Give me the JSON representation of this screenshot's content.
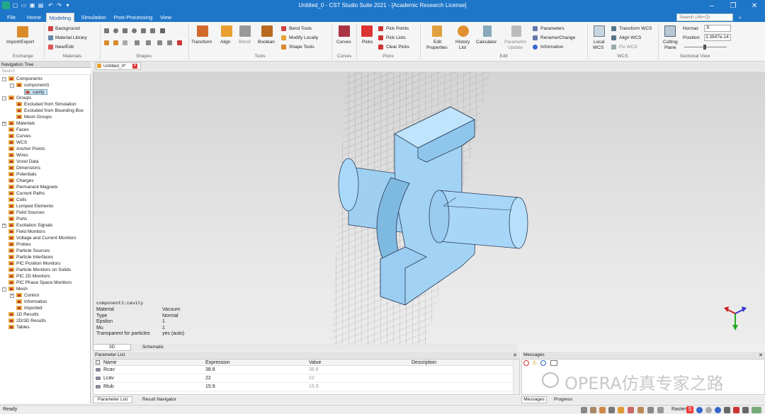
{
  "title": "Untitled_0 - CST Studio Suite 2021 - [Academic Research License]",
  "menu_tabs": [
    "File",
    "Home",
    "Modeling",
    "Simulation",
    "Post-Processing",
    "View"
  ],
  "active_tab": "Modeling",
  "search_placeholder": "Search (Alt+Q)",
  "ribbon": {
    "exchange": {
      "label": "Exchange",
      "import_export": "Import/Export"
    },
    "materials": {
      "label": "Materials",
      "background": "Background",
      "material_library": "Material Library",
      "new_edit": "New/Edit"
    },
    "shapes": {
      "label": "Shapes"
    },
    "tools": {
      "label": "Tools",
      "transform": "Transform",
      "align": "Align",
      "blend": "Blend",
      "boolean": "Boolean",
      "bend_tools": "Bend Tools",
      "modify_locally": "Modify Locally",
      "shape_tools": "Shape Tools"
    },
    "curves": {
      "label": "Curves",
      "curves": "Curves"
    },
    "picks": {
      "label": "Picks",
      "picks": "Picks",
      "pick_points": "Pick Points",
      "pick_lists": "Pick Lists",
      "clear_picks": "Clear Picks"
    },
    "edit": {
      "label": "Edit",
      "edit_properties_1": "Edit",
      "edit_properties_2": "Properties",
      "history_list_1": "History",
      "history_list_2": "List",
      "calculator": "Calculator",
      "parametric_update_1": "Parametric",
      "parametric_update_2": "Update",
      "parameters": "Parameters",
      "rename_change": "Rename/Change",
      "information": "Information"
    },
    "wcs": {
      "label": "WCS",
      "local_wcs_1": "Local",
      "local_wcs_2": "WCS",
      "transform_wcs": "Transform WCS",
      "align_wcs": "Align WCS",
      "fix_wcs": "Fix WCS"
    },
    "sectional": {
      "label": "Sectional View",
      "cutting_plane_1": "Cutting",
      "cutting_plane_2": "Plane",
      "normal_label": "Normal:",
      "normal_value": "X",
      "position_label": "Position:",
      "position_value": "3.3947e-14"
    }
  },
  "doc_tab": "Untitled_0*",
  "nav": {
    "title": "Navigation Tree",
    "search": "Search",
    "items": [
      {
        "label": "Components",
        "lvl": 0,
        "exp": "-"
      },
      {
        "label": "component1",
        "lvl": 1,
        "exp": "-"
      },
      {
        "label": "cavity",
        "lvl": 2,
        "exp": "",
        "sel": true
      },
      {
        "label": "Groups",
        "lvl": 0,
        "exp": "-"
      },
      {
        "label": "Excluded from Simulation",
        "lvl": 1,
        "exp": ""
      },
      {
        "label": "Excluded from Bounding Box",
        "lvl": 1,
        "exp": ""
      },
      {
        "label": "Mesh Groups",
        "lvl": 1,
        "exp": ""
      },
      {
        "label": "Materials",
        "lvl": 0,
        "exp": "+"
      },
      {
        "label": "Faces",
        "lvl": 0,
        "exp": ""
      },
      {
        "label": "Curves",
        "lvl": 0,
        "exp": ""
      },
      {
        "label": "WCS",
        "lvl": 0,
        "exp": ""
      },
      {
        "label": "Anchor Points",
        "lvl": 0,
        "exp": ""
      },
      {
        "label": "Wires",
        "lvl": 0,
        "exp": ""
      },
      {
        "label": "Voxel Data",
        "lvl": 0,
        "exp": ""
      },
      {
        "label": "Dimensions",
        "lvl": 0,
        "exp": ""
      },
      {
        "label": "Potentials",
        "lvl": 0,
        "exp": ""
      },
      {
        "label": "Charges",
        "lvl": 0,
        "exp": ""
      },
      {
        "label": "Permanent Magnets",
        "lvl": 0,
        "exp": ""
      },
      {
        "label": "Current Paths",
        "lvl": 0,
        "exp": ""
      },
      {
        "label": "Coils",
        "lvl": 0,
        "exp": ""
      },
      {
        "label": "Lumped Elements",
        "lvl": 0,
        "exp": ""
      },
      {
        "label": "Field Sources",
        "lvl": 0,
        "exp": ""
      },
      {
        "label": "Ports",
        "lvl": 0,
        "exp": ""
      },
      {
        "label": "Excitation Signals",
        "lvl": 0,
        "exp": "+"
      },
      {
        "label": "Field Monitors",
        "lvl": 0,
        "exp": ""
      },
      {
        "label": "Voltage and Current Monitors",
        "lvl": 0,
        "exp": ""
      },
      {
        "label": "Probes",
        "lvl": 0,
        "exp": ""
      },
      {
        "label": "Particle Sources",
        "lvl": 0,
        "exp": ""
      },
      {
        "label": "Particle Interfaces",
        "lvl": 0,
        "exp": ""
      },
      {
        "label": "PIC Position Monitors",
        "lvl": 0,
        "exp": ""
      },
      {
        "label": "Particle Monitors on Solids",
        "lvl": 0,
        "exp": ""
      },
      {
        "label": "PIC 2D Monitors",
        "lvl": 0,
        "exp": ""
      },
      {
        "label": "PIC Phase Space Monitors",
        "lvl": 0,
        "exp": ""
      },
      {
        "label": "Mesh",
        "lvl": 0,
        "exp": "-"
      },
      {
        "label": "Control",
        "lvl": 1,
        "exp": "+"
      },
      {
        "label": "Information",
        "lvl": 1,
        "exp": ""
      },
      {
        "label": "Imported",
        "lvl": 1,
        "exp": ""
      },
      {
        "label": "1D Results",
        "lvl": 0,
        "exp": ""
      },
      {
        "label": "2D/3D Results",
        "lvl": 0,
        "exp": ""
      },
      {
        "label": "Tables",
        "lvl": 0,
        "exp": ""
      }
    ]
  },
  "info": {
    "header": "component1:cavity",
    "rows": [
      {
        "k": "Material",
        "v": "Vacuum"
      },
      {
        "k": "Type",
        "v": "Normal"
      },
      {
        "k": "Epsilon",
        "v": "1"
      },
      {
        "k": "Mu",
        "v": "1"
      },
      {
        "k": "Transparent for particles",
        "v": "yes (auto)"
      }
    ]
  },
  "view_tabs": [
    "3D",
    "Schematic"
  ],
  "params": {
    "title": "Parameter List",
    "columns": [
      "Name",
      "Expression",
      "Value",
      "Description"
    ],
    "rows": [
      {
        "name": "Rcav",
        "expr": "38.8",
        "value": "38.8"
      },
      {
        "name": "Lcav",
        "expr": "22",
        "value": "22"
      },
      {
        "name": "Rtub",
        "expr": "15.9",
        "value": "15.9"
      }
    ]
  },
  "messages": {
    "title": "Messages",
    "watermark": "OPERA仿真专家之路"
  },
  "bottom_tabs": [
    "Parameter List",
    "Result Navigator",
    "Messages",
    "Progress"
  ],
  "status": {
    "left": "Ready",
    "raster": "Raster"
  }
}
